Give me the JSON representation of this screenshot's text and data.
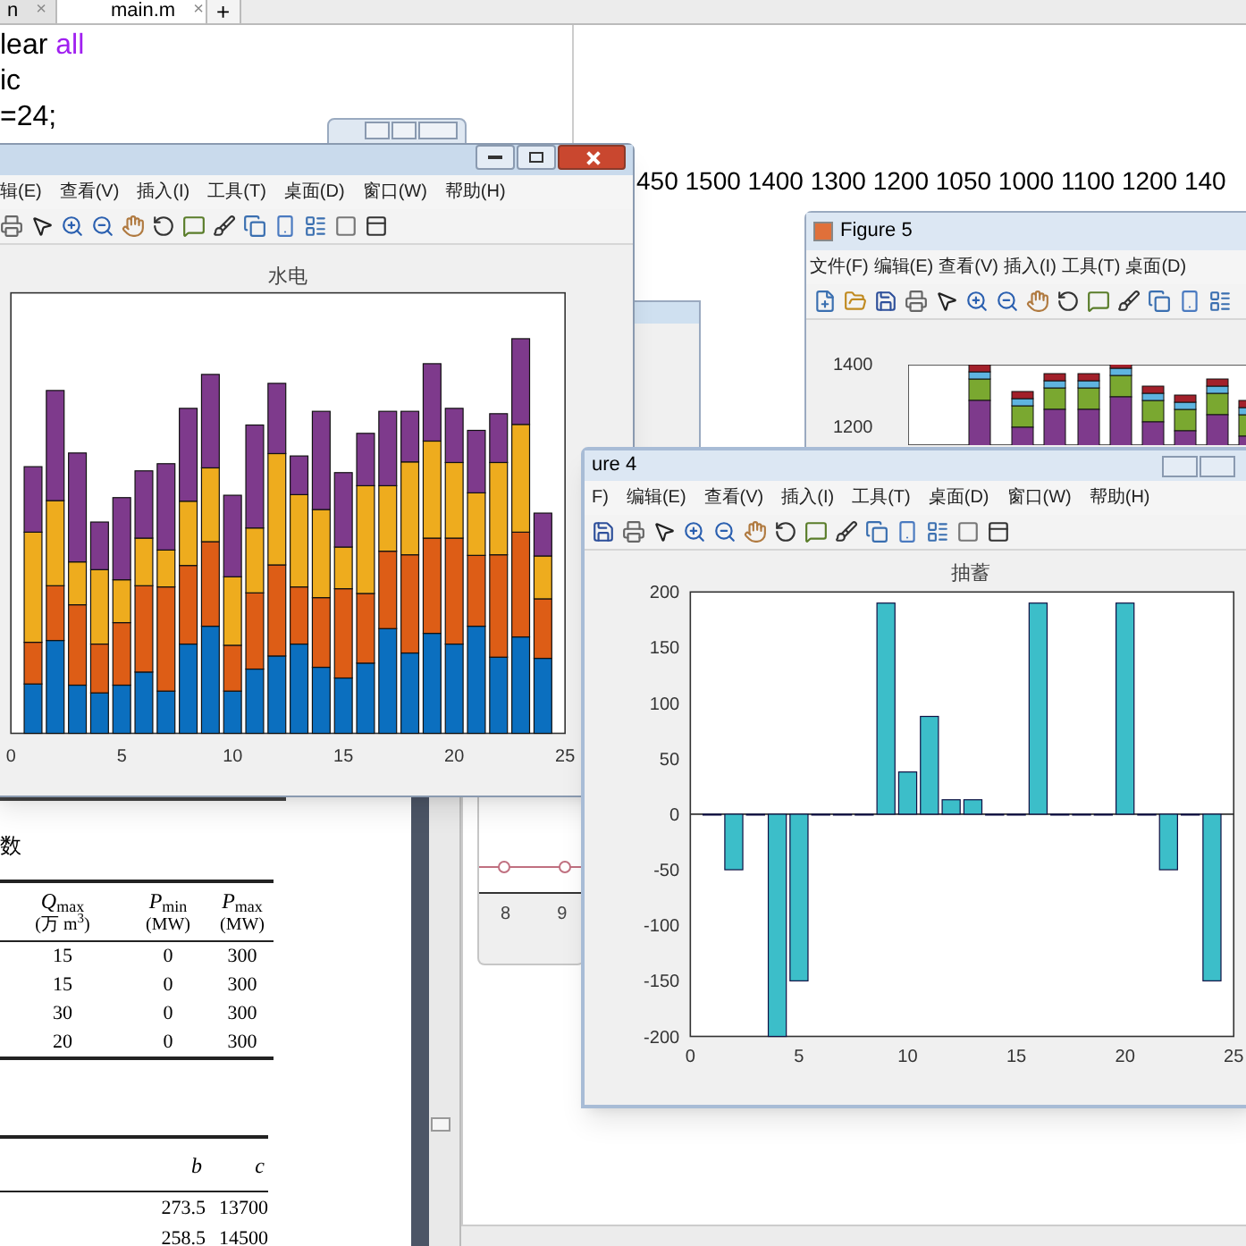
{
  "editor": {
    "tabs": [
      {
        "label": "n",
        "close": "×",
        "selected": false
      },
      {
        "label": "main.m",
        "close": "×",
        "selected": true
      }
    ],
    "new_tab": "+",
    "lines": [
      [
        {
          "text": "lear ",
          "kind": "plain"
        },
        {
          "text": "all",
          "kind": "string"
        }
      ],
      [
        {
          "text": "ic",
          "kind": "plain"
        }
      ],
      [
        {
          "text": "=24;",
          "kind": "plain"
        }
      ]
    ]
  },
  "command_output": "450 1500 1400 1300 1200 1050 1000 1100 1200 140",
  "figure_hydro": {
    "menu": [
      "辑(E)",
      "查看(V)",
      "插入(I)",
      "工具(T)",
      "桌面(D)",
      "窗口(W)",
      "帮助(H)"
    ],
    "chart_title": "水电",
    "x_ticks": [
      "0",
      "5",
      "10",
      "15",
      "20",
      "25"
    ]
  },
  "figure_5": {
    "title": "Figure 5",
    "menu": [
      "文件(F)",
      "编辑(E)",
      "查看(V)",
      "插入(I)",
      "工具(T)",
      "桌面(D)"
    ],
    "y_ticks": [
      "1400",
      "1200"
    ]
  },
  "figure_4": {
    "title": "ure 4",
    "menu": [
      "F)",
      "编辑(E)",
      "查看(V)",
      "插入(I)",
      "工具(T)",
      "桌面(D)",
      "窗口(W)",
      "帮助(H)"
    ],
    "chart_data": {
      "type": "bar",
      "title": "抽蓄",
      "x": [
        1,
        2,
        3,
        4,
        5,
        6,
        7,
        8,
        9,
        10,
        11,
        12,
        13,
        14,
        15,
        16,
        17,
        18,
        19,
        20,
        21,
        22,
        23,
        24
      ],
      "values": [
        0,
        -50,
        0,
        -200,
        -150,
        0,
        0,
        0,
        190,
        38,
        88,
        13,
        13,
        0,
        0,
        190,
        0,
        0,
        0,
        190,
        0,
        -50,
        0,
        -150
      ],
      "xlim": [
        0,
        25
      ],
      "ylim": [
        -200,
        200
      ],
      "xticks": [
        0,
        5,
        10,
        15,
        20,
        25
      ],
      "yticks": [
        -200,
        -150,
        -100,
        -50,
        0,
        50,
        100,
        150,
        200
      ]
    }
  },
  "document": {
    "heading": "数",
    "table_1": {
      "columns": [
        {
          "symbol": "*Q*$_{max}$",
          "unit": "(万 m$^{3}$)"
        },
        {
          "symbol": "*P*$_{min}$",
          "unit": "(MW)"
        },
        {
          "symbol": "*P*$_{max}$",
          "unit": "(MW)"
        }
      ],
      "rows": [
        [
          "15",
          "0",
          "300"
        ],
        [
          "15",
          "0",
          "300"
        ],
        [
          "30",
          "0",
          "300"
        ],
        [
          "20",
          "0",
          "300"
        ]
      ]
    },
    "table_2": {
      "columns": [
        "b",
        "c"
      ],
      "rows": [
        [
          "273.5",
          "13700"
        ],
        [
          "258.5",
          "14500"
        ]
      ]
    }
  },
  "side_window": {
    "x_ticks": [
      "8",
      "9"
    ]
  }
}
